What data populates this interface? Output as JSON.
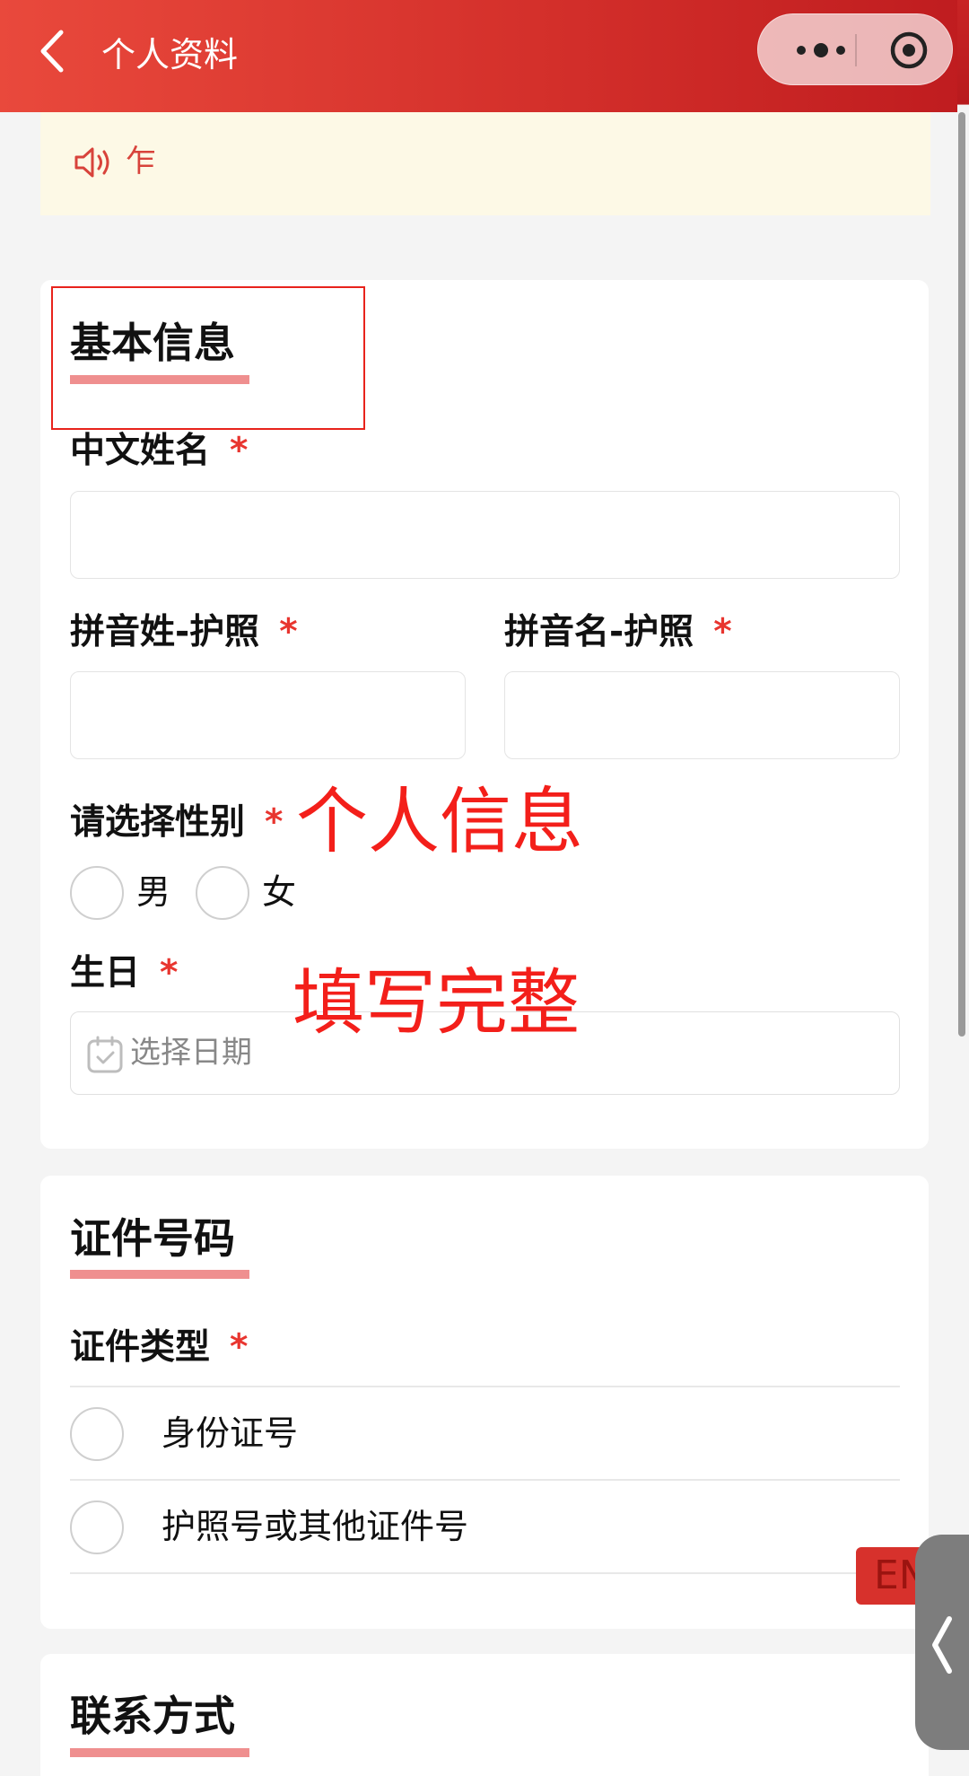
{
  "header": {
    "title": "个人资料"
  },
  "notice": {
    "text": "乍"
  },
  "basic_info": {
    "title": "基本信息",
    "chinese_name_label": "中文姓名",
    "pinyin_surname_label": "拼音姓-护照",
    "pinyin_given_label": "拼音名-护照",
    "gender_label": "请选择性别",
    "gender_options": [
      "男",
      "女"
    ],
    "birthday_label": "生日",
    "birthday_placeholder": "选择日期",
    "required_mark": "*"
  },
  "annotations": {
    "personal_info": "个人信息",
    "fill_complete": "填写完整"
  },
  "id_section": {
    "title": "证件号码",
    "type_label": "证件类型",
    "options": [
      "身份证号",
      "护照号或其他证件号"
    ],
    "required_mark": "*"
  },
  "contact_section": {
    "title": "联系方式"
  },
  "language_badge": {
    "text": "EN"
  },
  "colors": {
    "header_start": "#e9493c",
    "header_end": "#bf1c1f",
    "accent_underline": "#ef8f8f",
    "required": "#e8352f",
    "annotation": "#f31f1a",
    "notice_bg": "#fdf9e6"
  }
}
